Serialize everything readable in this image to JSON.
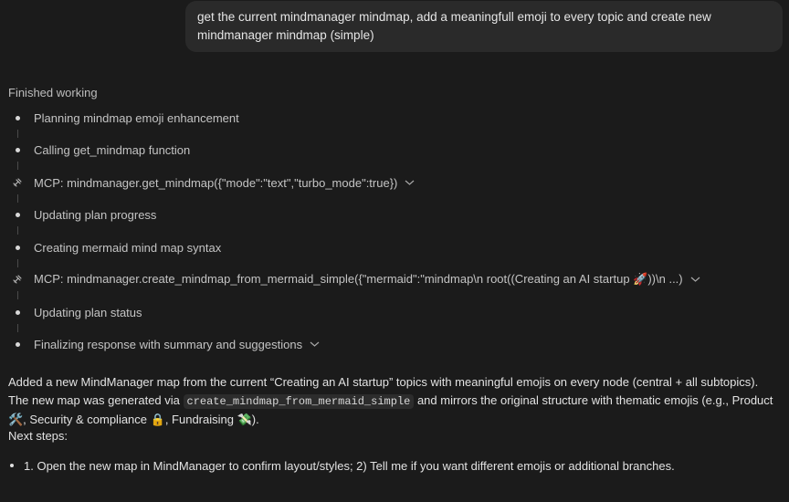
{
  "user_message": "get the current mindmanager mindmap, add a meaningfull emoji to every topic and create new mindmanager mindmap (simple)",
  "status_label": "Finished working",
  "steps": [
    {
      "label": "Planning mindmap emoji enhancement",
      "kind": "step"
    },
    {
      "label": "Calling get_mindmap function",
      "kind": "step"
    },
    {
      "label": "MCP: mindmanager.get_mindmap({\"mode\":\"text\",\"turbo_mode\":true})",
      "kind": "mcp"
    },
    {
      "label": "Updating plan progress",
      "kind": "step"
    },
    {
      "label": "Creating mermaid mind map syntax",
      "kind": "step"
    },
    {
      "label": "MCP: mindmanager.create_mindmap_from_mermaid_simple({\"mermaid\":\"mindmap\\n root((Creating an AI startup 🚀))\\n ...)",
      "kind": "mcp"
    },
    {
      "label": "Updating plan status",
      "kind": "step"
    },
    {
      "label": "Finalizing response with summary and suggestions",
      "kind": "step"
    }
  ],
  "summary": {
    "part1": "Added a new MindManager map from the current “Creating an AI startup” topics with meaningful emojis on every node (central + all subtopics). The new map was generated via ",
    "code": "create_mindmap_from_mermaid_simple",
    "part2": " and mirrors the original structure with thematic emojis (e.g., Product 🛠️, Security & compliance 🔒, Fundraising 💸)."
  },
  "next_steps_label": "Next steps:",
  "next_steps_item": "1. Open the new map in MindManager to confirm layout/styles; 2) Tell me if you want different emojis or additional branches."
}
